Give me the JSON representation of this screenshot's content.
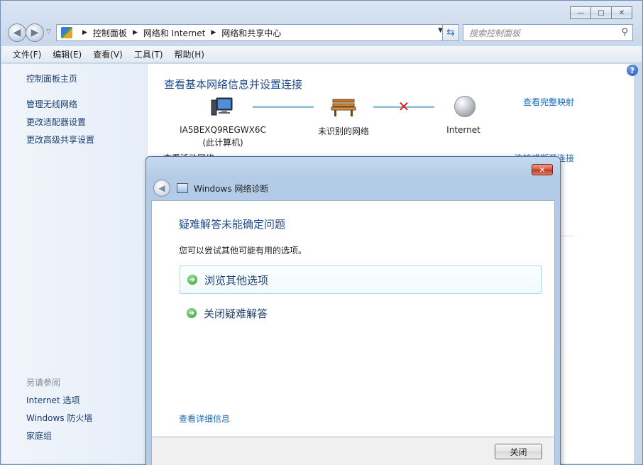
{
  "window": {
    "caption_buttons": [
      "—",
      "□",
      "✕"
    ],
    "address": {
      "crumbs": [
        "控制面板",
        "网络和 Internet",
        "网络和共享中心"
      ]
    },
    "search_placeholder": "搜索控制面板",
    "menu": [
      "文件(F)",
      "编辑(E)",
      "查看(V)",
      "工具(T)",
      "帮助(H)"
    ]
  },
  "sidebar": {
    "home": "控制面板主页",
    "tasks": [
      "管理无线网络",
      "更改适配器设置",
      "更改高级共享设置"
    ],
    "see_also_heading": "另请参阅",
    "see_also": [
      "Internet 选项",
      "Windows 防火墙",
      "家庭组"
    ]
  },
  "main": {
    "title": "查看基本网络信息并设置连接",
    "full_map_link": "查看完整映射",
    "computer_name": "IA5BEXQ9REGWX6C",
    "computer_sub": "(此计算机)",
    "network_label": "未识别的网络",
    "internet_label": "Internet",
    "partial_heading": "查看活动网络",
    "partial_link": "连接或断开连接",
    "help_glyph": "?"
  },
  "dialog": {
    "title": "Windows 网络诊断",
    "close_glyph": "✕",
    "heading": "疑难解答未能确定问题",
    "description": "您可以尝试其他可能有用的选项。",
    "options": [
      "浏览其他选项",
      "关闭疑难解答"
    ],
    "details_link": "查看详细信息",
    "close_button": "关闭"
  },
  "colors": {
    "link": "#1a6bb5",
    "heading": "#1e4a8c",
    "error_x": "#d42020"
  }
}
